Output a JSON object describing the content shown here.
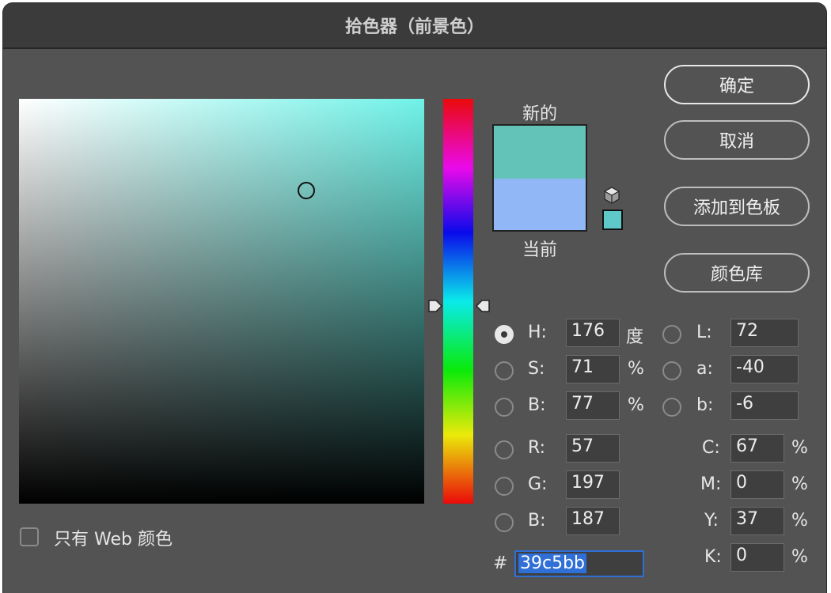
{
  "window": {
    "title": "拾色器（前景色）"
  },
  "buttons": {
    "ok": "确定",
    "cancel": "取消",
    "add_to_swatches": "添加到色板",
    "color_libraries": "颜色库"
  },
  "swatch": {
    "new_label": "新的",
    "current_label": "当前",
    "new_color": "#63c3b9",
    "current_color": "#91b7f6",
    "websafe_color": "#5fc8c9"
  },
  "hsb": {
    "h_label": "H:",
    "h_value": "176",
    "h_unit": "度",
    "s_label": "S:",
    "s_value": "71",
    "s_unit": "%",
    "b_label": "B:",
    "b_value": "77",
    "b_unit": "%"
  },
  "lab": {
    "l_label": "L:",
    "l_value": "72",
    "a_label": "a:",
    "a_value": "-40",
    "b_label": "b:",
    "b_value": "-6"
  },
  "rgb": {
    "r_label": "R:",
    "r_value": "57",
    "g_label": "G:",
    "g_value": "197",
    "b_label": "B:",
    "b_value": "187"
  },
  "cmyk": {
    "c_label": "C:",
    "c_value": "67",
    "m_label": "M:",
    "m_value": "0",
    "y_label": "Y:",
    "y_value": "37",
    "k_label": "K:",
    "k_value": "0",
    "unit": "%"
  },
  "hex": {
    "label": "#",
    "value": "39c5bb"
  },
  "web_only": {
    "label": "只有 Web 颜色",
    "checked": false
  }
}
